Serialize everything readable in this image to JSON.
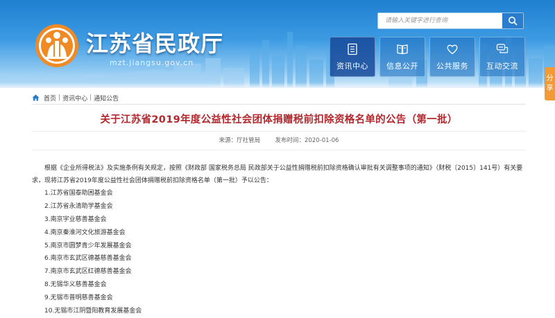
{
  "header": {
    "site_title": "江苏省民政厅",
    "site_domain": "mzt.jiangsu.gov.cn",
    "search": {
      "placeholder": "请输入关键字进行查询"
    },
    "nav": [
      {
        "label": "资讯中心",
        "icon": "news-icon",
        "active": true
      },
      {
        "label": "信息公开",
        "icon": "book-icon",
        "active": false
      },
      {
        "label": "公共服务",
        "icon": "heart-icon",
        "active": false
      },
      {
        "label": "互动交流",
        "icon": "chat-icon",
        "active": false
      }
    ],
    "share_label_1": "分",
    "share_label_2": "享"
  },
  "colors": {
    "banner_blue": "#2a84d2",
    "title_red": "#b3282d",
    "logo_orange": "#f08a24",
    "share_orange": "#f29a33"
  },
  "breadcrumb": {
    "items": [
      "首页",
      "资讯中心",
      "通知公告"
    ],
    "separator": "|"
  },
  "article": {
    "title": "关于江苏省2019年度公益性社会团体捐赠税前扣除资格名单的公告（第一批）",
    "source": "来源：厅社管局",
    "date": "发布时间：2020-01-06",
    "intro": "根据《企业所得税法》及实施条例有关规定，按照《财政部 国家税务总局 民政部关于公益性捐赠税前扣除资格确认审批有关调整事项的通知》（财税〔2015〕141号）有关要求，现将江苏省2019年度公益性社会团体捐赠税前扣除资格名单（第一批）予以公告：",
    "list": [
      "1.江苏省国泰助困基金会",
      "2.江苏省永清助学基金会",
      "3.南京宇业慈善基金会",
      "4.南京秦淮河文化旅游基金会",
      "5.南京市圆梦青少年发展基金会",
      "6.南京市玄武区德基慈善基金会",
      "7.南京市玄武区红德慈善基金会",
      "8.无锡华义慈善基金会",
      "9.无锡市普明慈善基金会",
      "10.无锡市江阴暨阳教育发展基金会"
    ]
  }
}
